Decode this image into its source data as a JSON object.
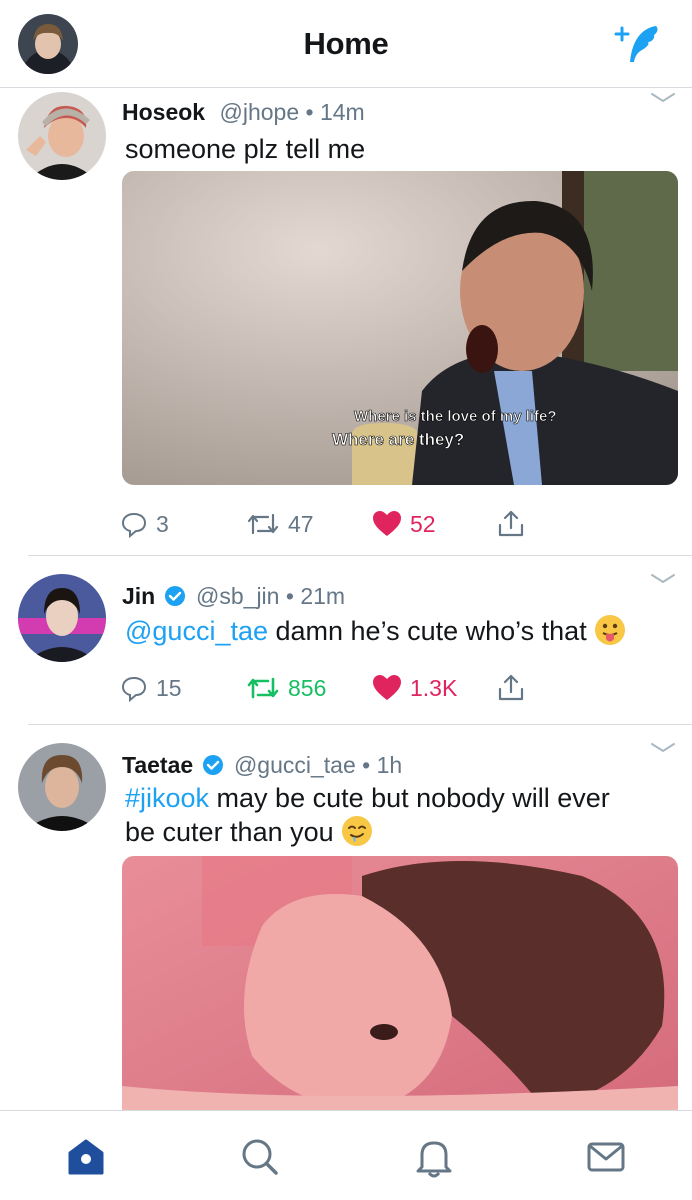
{
  "header": {
    "title": "Home",
    "avatar_icon": "user-avatar",
    "compose_icon": "sparkle-feather-icon"
  },
  "tweets": [
    {
      "name": "Hoseok",
      "verified": false,
      "handle": "@jhope",
      "dot": "•",
      "time": "14m",
      "text": "someone plz tell me",
      "media": {
        "caption_line1": "Where is the love of my life?",
        "caption_line2": "Where are they?"
      },
      "replies": "3",
      "retweets": "47",
      "likes": "52",
      "liked": true,
      "retweeted": false
    },
    {
      "name": "Jin",
      "verified": true,
      "handle": "@sb_jin",
      "dot": "•",
      "time": "21m",
      "mention": "@gucci_tae",
      "text": " damn he’s cute who’s that",
      "emoji": "tongue-face-emoji",
      "replies": "15",
      "retweets": "856",
      "likes": "1.3K",
      "liked": true,
      "retweeted": true
    },
    {
      "name": "Taetae",
      "verified": true,
      "handle": "@gucci_tae",
      "dot": "•",
      "time": "1h",
      "hashtag": "#jikook",
      "text_line1": " may be cute but nobody will ever",
      "text_line2": "be cuter than you",
      "emoji": "drooling-face-emoji"
    }
  ],
  "colors": {
    "accent": "#1da1f2",
    "like": "#e0245e",
    "retweet": "#17bf63",
    "muted": "#657786",
    "divider": "#d7dbdf",
    "tab_active": "#1da1f2"
  },
  "tabbar": {
    "items": [
      "home-icon",
      "search-icon",
      "notifications-icon",
      "messages-icon"
    ],
    "active": "home-icon"
  }
}
